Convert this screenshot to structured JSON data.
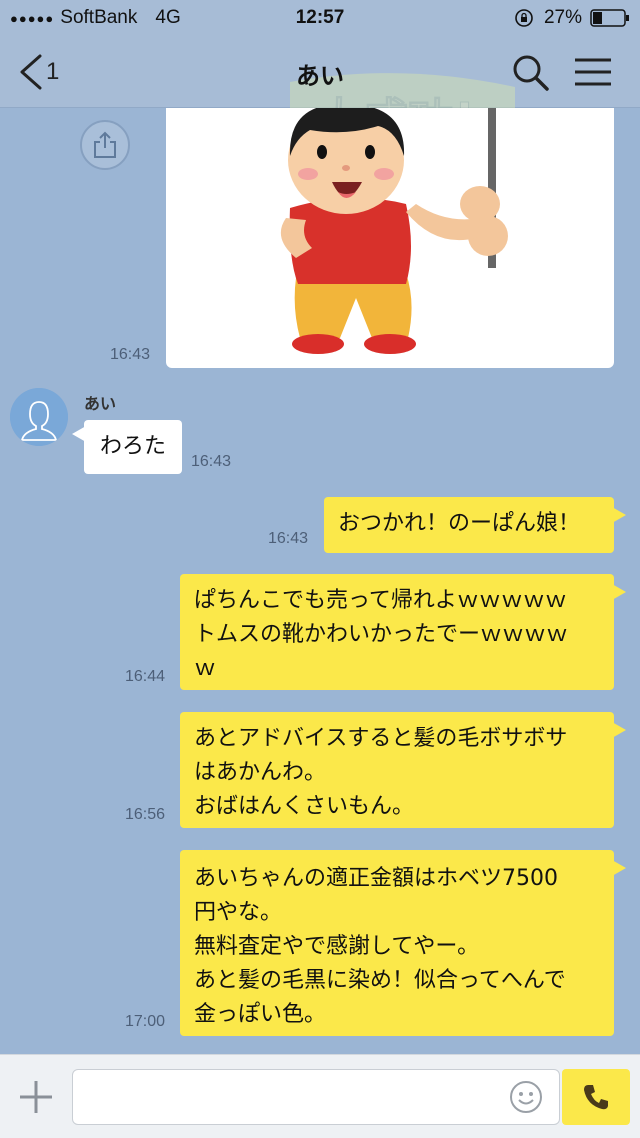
{
  "status_bar": {
    "signal_dots": "●●●●●",
    "carrier": "SoftBank",
    "network": "4G",
    "time": "12:57",
    "battery": "27%"
  },
  "header": {
    "back_count": "1",
    "title": "あい",
    "banner_text": "大成功!"
  },
  "messages": {
    "image": {
      "time": "16:43"
    },
    "incoming": {
      "sender": "あい",
      "text": "わろた",
      "time": "16:43"
    },
    "out1": {
      "lines": [
        "おつかれ！のーぱん娘！"
      ],
      "time": "16:43"
    },
    "out2": {
      "lines": [
        "ぱちんこでも売って帰れよｗｗｗｗｗ",
        "トムスの靴かわいかったでーｗｗｗｗ",
        "ｗ"
      ],
      "time": "16:44"
    },
    "out3": {
      "lines": [
        "あとアドバイスすると髪の毛ボサボサ",
        "はあかんわ。",
        "おばはんくさいもん。"
      ],
      "time": "16:56"
    },
    "out4": {
      "lines": [
        "あいちゃんの適正金額はホベツ7500",
        "円やな。",
        "無料査定やで感謝してやー。",
        "あと髪の毛黒に染め！似合ってへんで",
        "金っぽい色。"
      ],
      "time": "17:00"
    }
  },
  "input": {
    "value": "",
    "placeholder": ""
  },
  "colors": {
    "background": "#9bb5d4",
    "outgoing_bubble": "#fbe84a",
    "incoming_bubble": "#ffffff"
  }
}
